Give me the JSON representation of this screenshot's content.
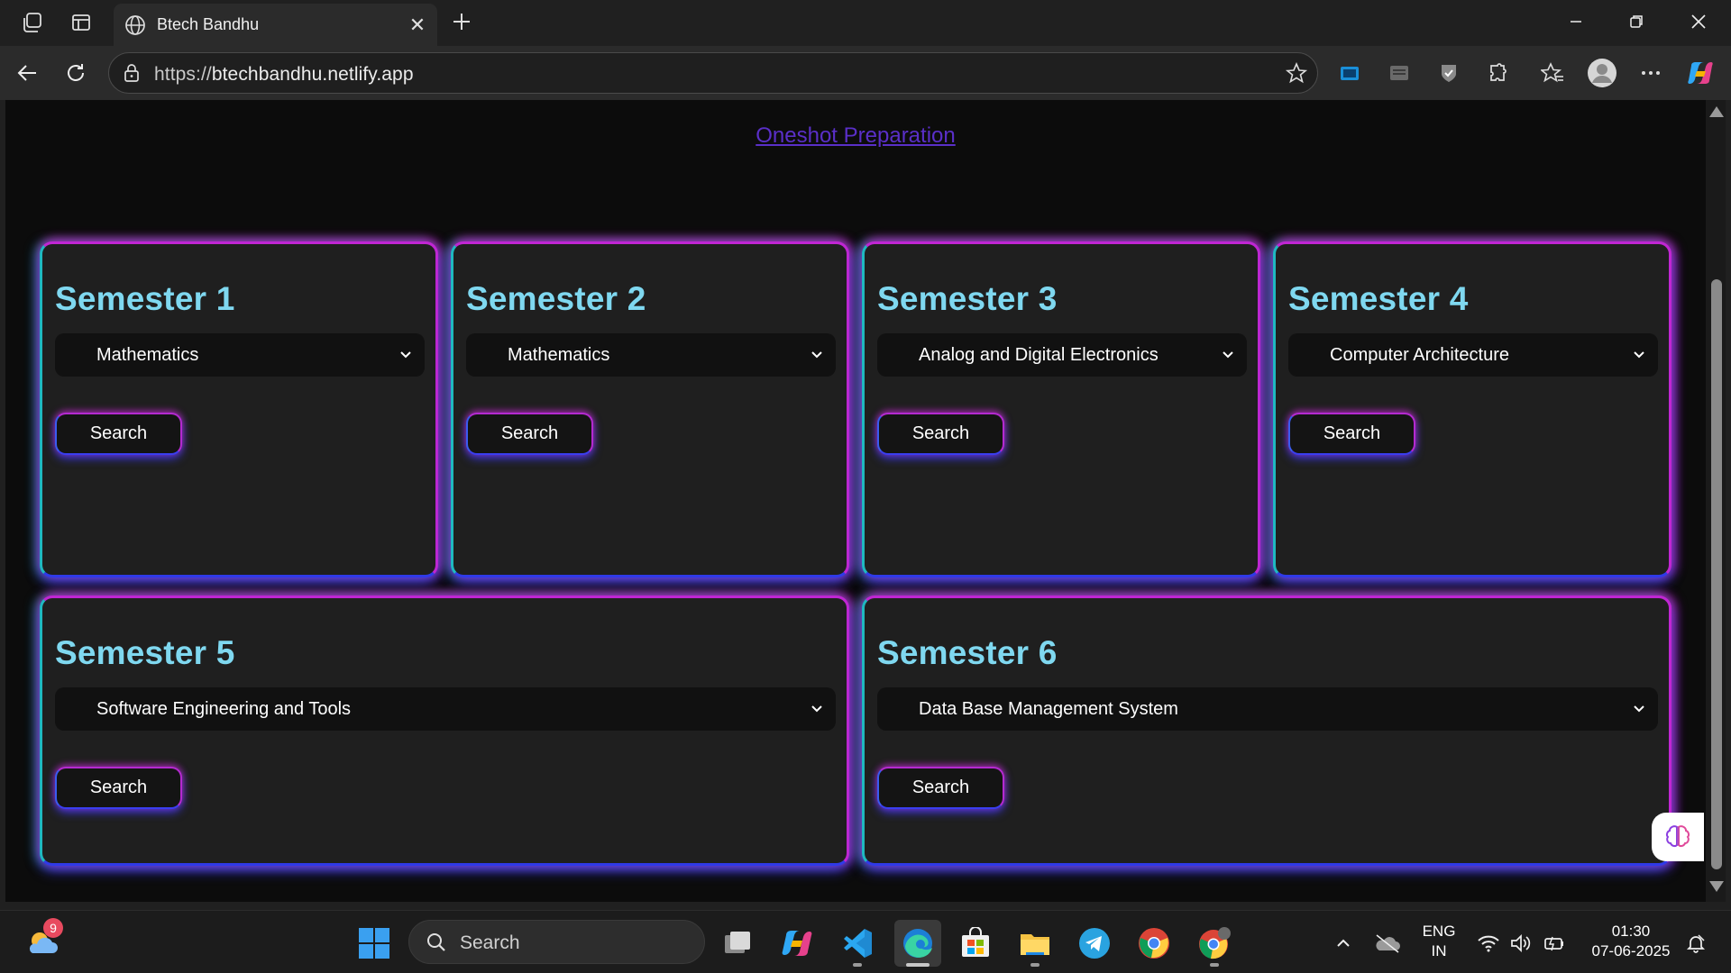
{
  "browser": {
    "tab_title": "Btech Bandhu",
    "url_protocol": "https://",
    "url_host": "btechbandhu.netlify.app"
  },
  "page": {
    "top_link": "Oneshot Preparation",
    "semesters": [
      {
        "title": "Semester 1",
        "selected_subject": "Mathematics",
        "button": "Search"
      },
      {
        "title": "Semester 2",
        "selected_subject": "Mathematics",
        "button": "Search"
      },
      {
        "title": "Semester 3",
        "selected_subject": "Analog and Digital Electronics",
        "button": "Search"
      },
      {
        "title": "Semester 4",
        "selected_subject": "Computer Architecture",
        "button": "Search"
      },
      {
        "title": "Semester 5",
        "selected_subject": "Software Engineering and Tools",
        "button": "Search"
      },
      {
        "title": "Semester 6",
        "selected_subject": "Data Base Management System",
        "button": "Search"
      }
    ]
  },
  "taskbar": {
    "weather_badge": "9",
    "search_label": "Search",
    "language": "ENG",
    "region": "IN",
    "time": "01:30",
    "date": "07-06-2025"
  },
  "colors": {
    "heading": "#7fd8f0",
    "glow_pink": "#c026d3",
    "glow_blue": "#2f3ae8",
    "glow_cyan": "#1fb8c0",
    "link": "#5a2fc8"
  }
}
